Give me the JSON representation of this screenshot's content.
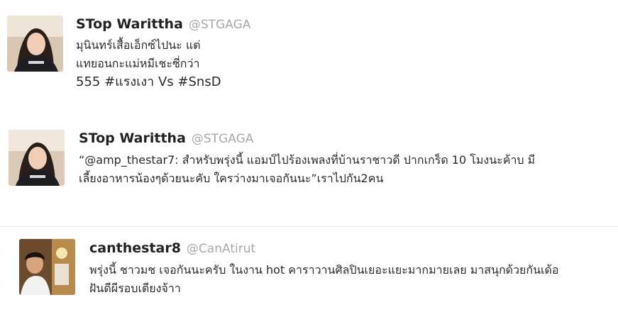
{
  "tweets": [
    {
      "name": "STop Warittha",
      "handle": "@STGAGA",
      "lines": [
        "มุนินทร์เสื้อเอ็กซ์ไปนะ แต่",
        "แทยอนกะแม่หมีเชะซี่กว่า",
        "555 #แรงเงา Vs #SnsD"
      ]
    },
    {
      "name": "STop Warittha",
      "handle": "@STGAGA",
      "lines": [
        "“@amp_thestar7: สำหรับพรุ่งนี้ แอมป์ไปร้องเพลงที่บ้านราชาวดี ปากเกร็ด 10 โมงนะค้าบ มี",
        "เลี้ยงอาหารน้องๆด้วยนะคับ ใครว่างมาเจอกันนะ”เราไปกัน2คน"
      ]
    },
    {
      "name": "canthestar8",
      "handle": "@CanAtirut",
      "lines": [
        "พรุ่งนี้ ชาวมช เจอกันนะครับ ในงาน hot คาราวานศิลปินเยอะแยะมากมายเลย มาสนุกด้วยกันเด้อ",
        "ฝันดีผีรอบเตียงจ้าา"
      ]
    }
  ]
}
